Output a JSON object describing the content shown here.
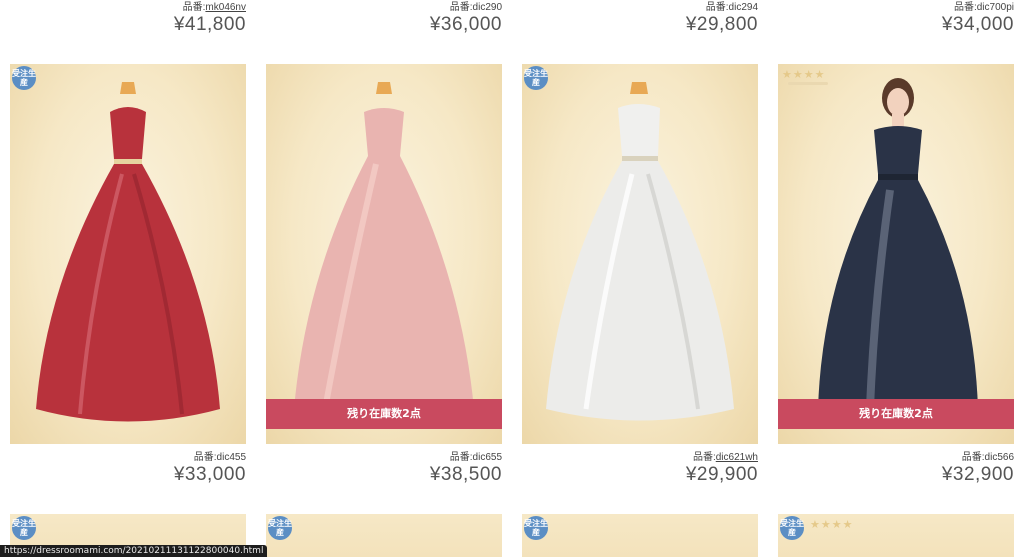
{
  "top_row": [
    {
      "code_label": "品番:",
      "code": "mk046nv",
      "linked": true,
      "price": "¥41,800"
    },
    {
      "code_label": "品番:",
      "code": "dic290",
      "linked": false,
      "price": "¥36,000"
    },
    {
      "code_label": "品番:",
      "code": "dic294",
      "linked": false,
      "price": "¥29,800"
    },
    {
      "code_label": "品番:",
      "code": "dic700pi",
      "linked": false,
      "price": "¥34,000"
    }
  ],
  "products": [
    {
      "code_label": "品番:",
      "code": "dic455",
      "linked": false,
      "price": "¥33,000",
      "badge": "受注生産",
      "dress_color": "#b8323c",
      "stock_label": ""
    },
    {
      "code_label": "品番:",
      "code": "dic655",
      "linked": false,
      "price": "¥38,500",
      "badge": "",
      "dress_color": "#e9b4b0",
      "stock_label": "残り在庫数2点"
    },
    {
      "code_label": "品番:",
      "code": "dic621wh",
      "linked": true,
      "price": "¥29,900",
      "badge": "受注生産",
      "dress_color": "#ececea",
      "stock_label": ""
    },
    {
      "code_label": "品番:",
      "code": "dic566",
      "linked": false,
      "price": "¥32,900",
      "badge": "stars",
      "dress_color": "#2a3347",
      "stock_label": "残り在庫数2点"
    }
  ],
  "bottom_row_badges": [
    "受注生産",
    "受注生産",
    "受注生産",
    "受注生産"
  ],
  "status_url": "https://dressroomami.com/20210211131122800040.html",
  "accent_color": "#c94a5f"
}
